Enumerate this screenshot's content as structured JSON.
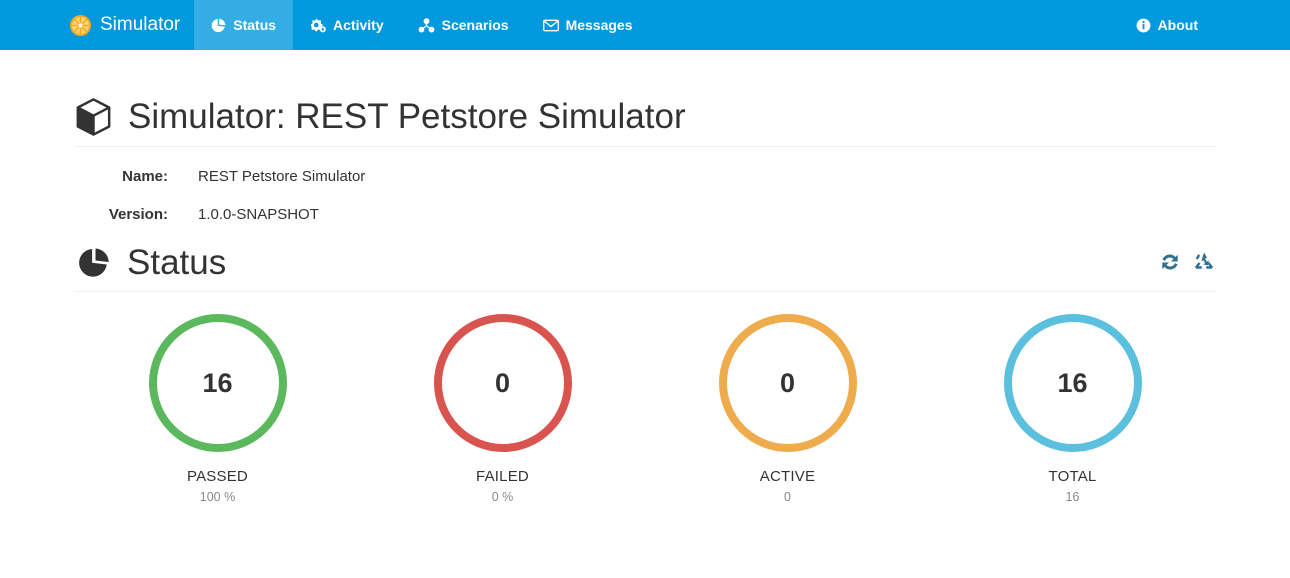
{
  "navbar": {
    "background_color": "#0099dd",
    "active_color": "#33ade4",
    "brand": {
      "label": "Simulator",
      "icon": "orange-slice-icon"
    },
    "items": [
      {
        "label": "Status",
        "icon": "pie-chart-icon",
        "active": true
      },
      {
        "label": "Activity",
        "icon": "cogs-icon",
        "active": false
      },
      {
        "label": "Scenarios",
        "icon": "cubes-icon",
        "active": false
      },
      {
        "label": "Messages",
        "icon": "envelope-icon",
        "active": false
      }
    ],
    "right_items": [
      {
        "label": "About",
        "icon": "info-circle-icon"
      }
    ]
  },
  "page": {
    "icon": "cube-icon",
    "title": "Simulator: REST Petstore Simulator",
    "details": [
      {
        "label": "Name:",
        "value": "REST Petstore Simulator"
      },
      {
        "label": "Version:",
        "value": "1.0.0-SNAPSHOT"
      }
    ]
  },
  "status_section": {
    "icon": "pie-chart-icon",
    "title": "Status",
    "actions": [
      {
        "name": "refresh-icon",
        "color": "#31708f",
        "title": "Refresh"
      },
      {
        "name": "recycle-icon",
        "color": "#31708f",
        "title": "Reset"
      }
    ],
    "cards": [
      {
        "value": "16",
        "label": "PASSED",
        "sub": "100 %",
        "color": "#5cb85c"
      },
      {
        "value": "0",
        "label": "FAILED",
        "sub": "0 %",
        "color": "#d9534f"
      },
      {
        "value": "0",
        "label": "ACTIVE",
        "sub": "0",
        "color": "#eeac4d"
      },
      {
        "value": "16",
        "label": "TOTAL",
        "sub": "16",
        "color": "#5bc0de"
      }
    ]
  },
  "chart_data": {
    "type": "bar",
    "title": "Status",
    "categories": [
      "PASSED",
      "FAILED",
      "ACTIVE",
      "TOTAL"
    ],
    "values": [
      16,
      0,
      0,
      16
    ],
    "sublabels": [
      "100 %",
      "0 %",
      "0",
      "16"
    ],
    "colors": [
      "#5cb85c",
      "#d9534f",
      "#eeac4d",
      "#5bc0de"
    ],
    "xlabel": "",
    "ylabel": "",
    "legend": "none"
  }
}
